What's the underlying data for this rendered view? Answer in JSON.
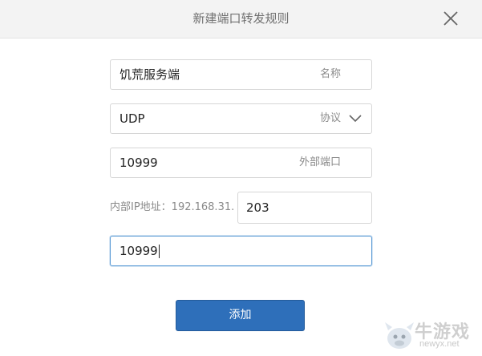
{
  "dialog": {
    "title": "新建端口转发规则"
  },
  "form": {
    "name": {
      "value": "饥荒服务端",
      "suffix_label": "名称"
    },
    "protocol": {
      "value": "UDP",
      "suffix_label": "协议"
    },
    "external_port": {
      "value": "10999",
      "suffix_label": "外部端口"
    },
    "internal_ip": {
      "prefix_label": "内部IP地址：192.168.31.",
      "value": "203"
    },
    "internal_port": {
      "value": "10999"
    }
  },
  "actions": {
    "add_label": "添加"
  },
  "watermark": {
    "brand": "牛游戏",
    "site": "newyx.net"
  },
  "colors": {
    "titlebar_bg": "#f3f3f3",
    "primary_button": "#2e6fba",
    "focus_border": "#5b9bd5"
  }
}
